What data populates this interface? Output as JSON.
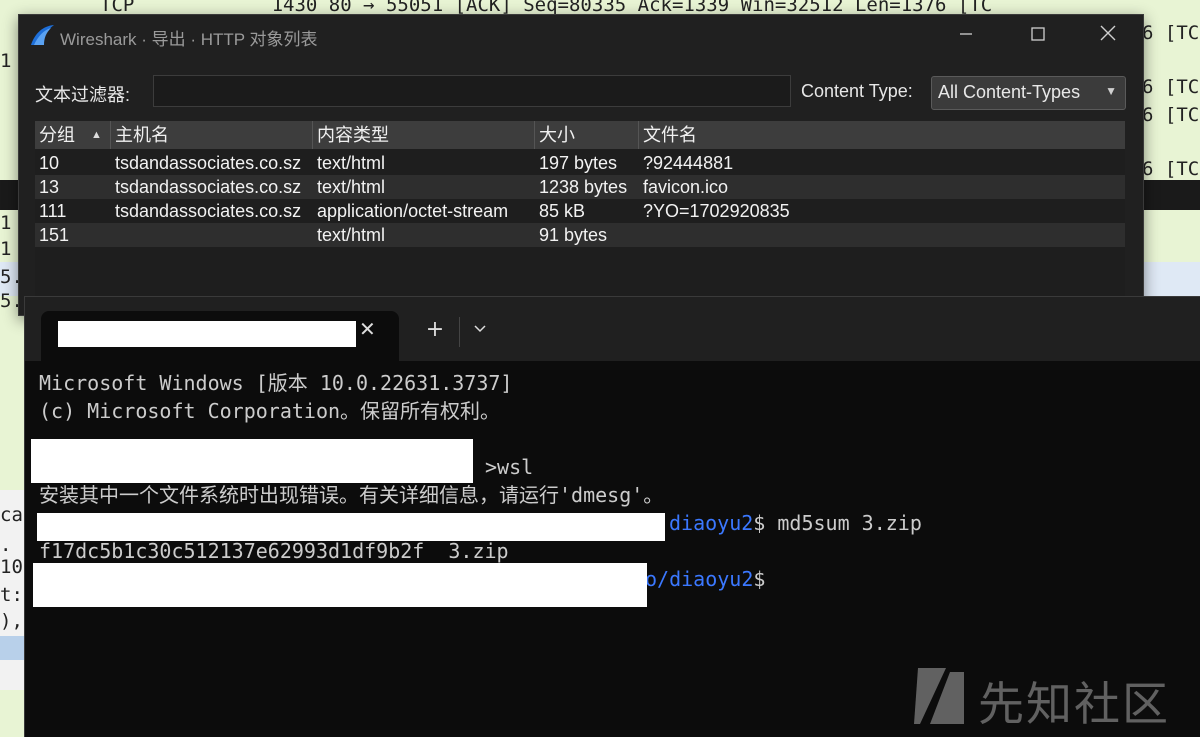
{
  "background": {
    "packet_top": "TCP            1430 80 → 55051 [ACK] Seq=80335 Ack=1339 Win=32512 Len=1376 [TC",
    "right_fragments": [
      "6 [TC",
      "6 [TC",
      "6 [TC",
      "6 [TC"
    ],
    "left_fragments": [
      "1",
      "1",
      "1",
      "5.",
      "5."
    ],
    "left_lower": [
      "ca",
      ".",
      "10",
      "t:",
      "),"
    ]
  },
  "dialog": {
    "title": "Wireshark · 导出 · HTTP 对象列表",
    "filter_label": "文本过滤器:",
    "filter_value": "",
    "content_type_label": "Content Type:",
    "content_type_value": "All Content-Types",
    "columns": [
      "分组",
      "主机名",
      "内容类型",
      "大小",
      "文件名"
    ],
    "rows": [
      {
        "packet": "10",
        "host": "tsdandassociates.co.sz",
        "type": "text/html",
        "size": "197 bytes",
        "filename": "?92444881"
      },
      {
        "packet": "13",
        "host": "tsdandassociates.co.sz",
        "type": "text/html",
        "size": "1238 bytes",
        "filename": "favicon.ico"
      },
      {
        "packet": "111",
        "host": "tsdandassociates.co.sz",
        "type": "application/octet-stream",
        "size": "85 kB",
        "filename": "?YO=1702920835"
      },
      {
        "packet": "151",
        "host": "",
        "type": "text/html",
        "size": "91 bytes",
        "filename": ""
      }
    ]
  },
  "terminal": {
    "new_tab": "+",
    "lines": {
      "l1": "Microsoft Windows [版本 10.0.22631.3737]",
      "l2": "(c) Microsoft Corporation。保留所有权利。",
      "l3_cmd": ">wsl",
      "l4": "安装其中一个文件系统时出现错误。有关详细信息，请运行'dmesg'。",
      "l5_path": "diaoyu2",
      "l5_cmd": "$ md5sum 3.zip",
      "l6": "f17dc5b1c30c512137e62993d1df9b2f  3.zip",
      "l7_path": "o/diaoyu2",
      "l7_prompt": "$"
    }
  },
  "watermark": {
    "text": "先知社区"
  },
  "colors": {
    "dialog_bg": "#202020",
    "terminal_bg": "#0c0c0c",
    "path_blue": "#3b78ff",
    "bg_green": "#e8f4d4"
  }
}
